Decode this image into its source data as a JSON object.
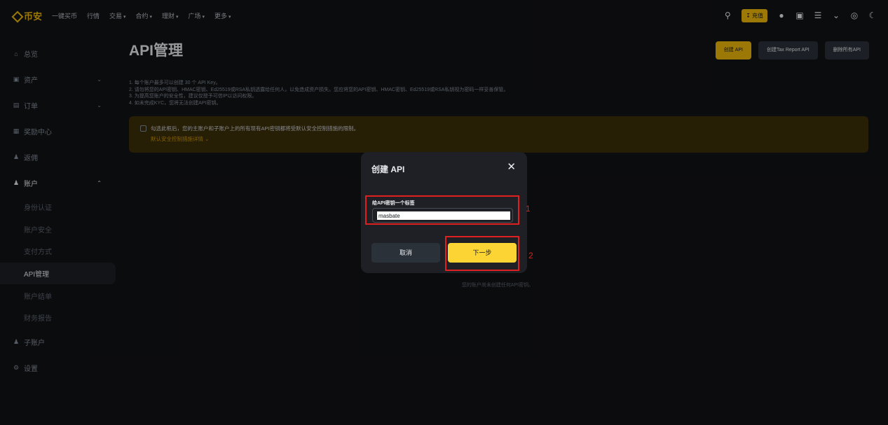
{
  "topbar": {
    "logo_text": "币安",
    "nav": [
      {
        "label": "一键买币",
        "caret": false
      },
      {
        "label": "行情",
        "caret": false
      },
      {
        "label": "交易",
        "caret": true
      },
      {
        "label": "合约",
        "caret": true
      },
      {
        "label": "理财",
        "caret": true
      },
      {
        "label": "广场",
        "caret": true
      },
      {
        "label": "更多",
        "caret": true
      }
    ],
    "deposit_label": "充值",
    "icons": [
      "search-icon",
      "user-icon",
      "wallet-icon",
      "orders-icon",
      "download-icon",
      "globe-icon",
      "moon-icon"
    ]
  },
  "sidebar": {
    "items": [
      {
        "label": "总览",
        "icon": "home-icon"
      },
      {
        "label": "资产",
        "icon": "wallet-icon",
        "chevron": "down"
      },
      {
        "label": "订单",
        "icon": "orders-icon",
        "chevron": "down"
      },
      {
        "label": "奖励中心",
        "icon": "reward-icon"
      },
      {
        "label": "返佣",
        "icon": "referral-icon"
      },
      {
        "label": "账户",
        "icon": "account-icon",
        "chevron": "up"
      }
    ],
    "account_sub": [
      "身份认证",
      "账户安全",
      "支付方式",
      "API管理",
      "账户结单",
      "财务报告"
    ],
    "active_sub": "API管理",
    "after": [
      {
        "label": "子账户",
        "icon": "subaccount-icon"
      },
      {
        "label": "设置",
        "icon": "settings-icon"
      }
    ]
  },
  "main": {
    "title": "API管理",
    "actions": [
      "创建 API",
      "创建Tax Report API",
      "删除所有API"
    ],
    "notes": [
      "1. 每个账户最多可以创建 30 个 API Key。",
      "2. 请勿将您的API密钥、HMAC密钥、Ed25519或RSA私钥透露给任何人，以免造成资产损失。您应将您的API密钥、HMAC密钥、Ed25519或RSA私钥视为密码一样妥善保管。",
      "3. 为提高您账户的安全性，建议仅授予可信IP以访问权限。",
      "4. 如未完成KYC，您将无法创建API密钥。"
    ],
    "notice_text": "勾选此框后，您的主账户和子账户上的所有现有API密钥都将受默认安全控制措施的限制。",
    "notice_link": "默认安全控制措施详情",
    "empty_text": "您的账户尚未创建任何API密钥。"
  },
  "modal": {
    "title": "创建 API",
    "field_label": "给API密钥一个标签",
    "field_value": "masbate",
    "cancel_label": "取消",
    "next_label": "下一步",
    "marker_1": "1",
    "marker_2": "2"
  },
  "colors": {
    "accent": "#F0B90B",
    "highlight": "#E02020",
    "bg": "#121315"
  }
}
